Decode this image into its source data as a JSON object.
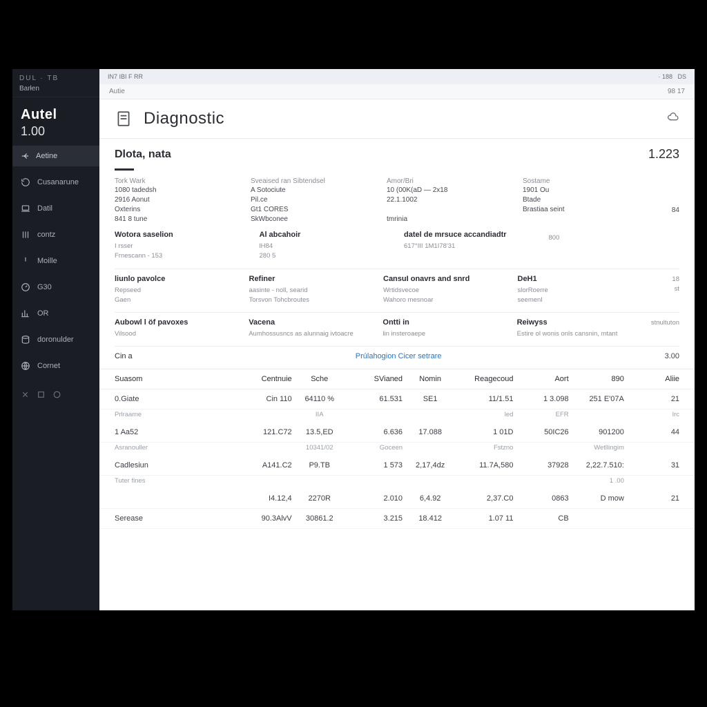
{
  "sidebar": {
    "top_line1": "DUL   · TB",
    "top_line2": "Barłen",
    "brand": "Autel",
    "version": "1.00",
    "active_label": "Aetine",
    "items": [
      {
        "label": "Cusanarune"
      },
      {
        "label": "Datil"
      },
      {
        "label": "contz"
      },
      {
        "label": "Moille"
      },
      {
        "label": "G30"
      },
      {
        "label": "OR"
      },
      {
        "label": "doronulder"
      },
      {
        "label": "Cornet"
      }
    ]
  },
  "status": {
    "left": "IN7   IBI   F   RR",
    "right_a": "· 188",
    "right_b": "DS"
  },
  "subheader": {
    "left": "Autie",
    "right": "98  17"
  },
  "page": {
    "title": "Diagnostic"
  },
  "section": {
    "title": "Dlota, nata",
    "value": "1.223"
  },
  "details_block": {
    "rows": [
      {
        "cols": [
          {
            "label": "Tork  Wark",
            "vals": [
              "1080 tadedsh",
              "2916 Aonut",
              "Oxterins",
              "841 8  tune"
            ]
          },
          {
            "label": "Sveaised ran Sibtendsel",
            "vals": [
              "A   Sotociute",
              "",
              "Pil.ce",
              "Gt1 CORES",
              "SkWbconee"
            ]
          },
          {
            "label": "Amor/Bri",
            "vals": [
              "10  (00K(aD — 2x18",
              "22.1.1002",
              "",
              "tmrinia"
            ]
          },
          {
            "label": "Sostame",
            "vals": [
              "1901 Ou",
              "Btade",
              "Brastiaa seint"
            ]
          }
        ],
        "extra_right": "84"
      }
    ]
  },
  "groups": [
    {
      "cells": [
        {
          "head": "Wotora saselion",
          "subs": [
            "I rsser",
            "Frnescann   - 153"
          ]
        },
        {
          "head": "Al abcahoir",
          "subs": [
            "lH84",
            "280 5"
          ]
        },
        {
          "head": "datel de mrsuce accandiadtr",
          "subs": [
            "617°III  1M1I78'31"
          ]
        },
        {
          "head": "",
          "subs": [
            "800"
          ]
        }
      ]
    },
    {
      "cells": [
        {
          "head": "liunlo pavolce",
          "subs": [
            "Repseed",
            "Gaen"
          ]
        },
        {
          "head": "Refiner",
          "subs": [
            "aasinte  -  noll, searid",
            "Torsvon   Tohcbroutes"
          ]
        },
        {
          "head": "CansuI onavrs and snrd",
          "subs": [
            "Wrtidsvecoe",
            "Wahoro mesnoar"
          ]
        },
        {
          "head": "DeH1",
          "subs": [
            "slorRoerre",
            "seemenI"
          ]
        }
      ],
      "extra_right": [
        "18",
        "st"
      ]
    },
    {
      "cells": [
        {
          "head": "Aubowl  l öf pavoxes",
          "subs": [
            "Vilsood"
          ]
        },
        {
          "head": "Vacena",
          "subs": [
            "Aumhossusncs as alunnaig ivtoacre"
          ]
        },
        {
          "head": "Ontti in",
          "subs": [
            "lin         insteroaepe"
          ]
        },
        {
          "head": "Reiwyss",
          "subs": [
            "Estire ol wonis onls cansnin, mtant"
          ]
        }
      ],
      "extra_right": "stnultuton"
    }
  ],
  "linkrow": {
    "left": "Cin  a",
    "center": "Prúlahogion Cicer setrare",
    "right": "3.00"
  },
  "table": {
    "headers": [
      "Suasom",
      "Centnuie",
      "Sche",
      "SVianed",
      "Nomin",
      "Reagecoud",
      "Aort",
      "890",
      "Aliie"
    ],
    "rows": [
      {
        "main": [
          "0.Giate",
          "Cin  110",
          "64110 %",
          "61.531",
          "SE1",
          "11/1.51",
          "1 3.098",
          "251 E'07A",
          "21"
        ],
        "sub": [
          "Prlraarne",
          "",
          "IIA",
          "",
          "",
          "led",
          "EFR",
          "",
          "Irc"
        ]
      },
      {
        "main": [
          "1 Aa52",
          "121.C72",
          "13.5,ED",
          "6.636",
          "17.088",
          "1 01D",
          "50IC26",
          "901200",
          "44"
        ],
        "sub": [
          "Asranouller",
          "",
          "10341/02",
          "Goceen",
          "",
          "Fstzno",
          "",
          "Wetllingim",
          ""
        ]
      },
      {
        "main": [
          "Cadlesiun",
          "A141.C2",
          "P9.TB",
          "1 573",
          "2,17,4dz",
          "11.7A,580",
          "37928",
          "2,22.7.510:",
          "31"
        ],
        "sub": [
          "Tuter fines",
          "",
          "",
          "",
          "",
          "",
          "",
          "1  .00",
          ""
        ]
      },
      {
        "main": [
          "",
          "I4.12,4",
          "2270R",
          "2.010",
          "6,4.92",
          "2,37.C0",
          "0863",
          "D      mow",
          "21"
        ],
        "sub": []
      },
      {
        "main": [
          "Serease",
          "90.3AlvV",
          "30861.2",
          "3.215",
          "18.412",
          "1.07 11",
          "CB",
          "",
          ""
        ],
        "sub": []
      }
    ]
  }
}
